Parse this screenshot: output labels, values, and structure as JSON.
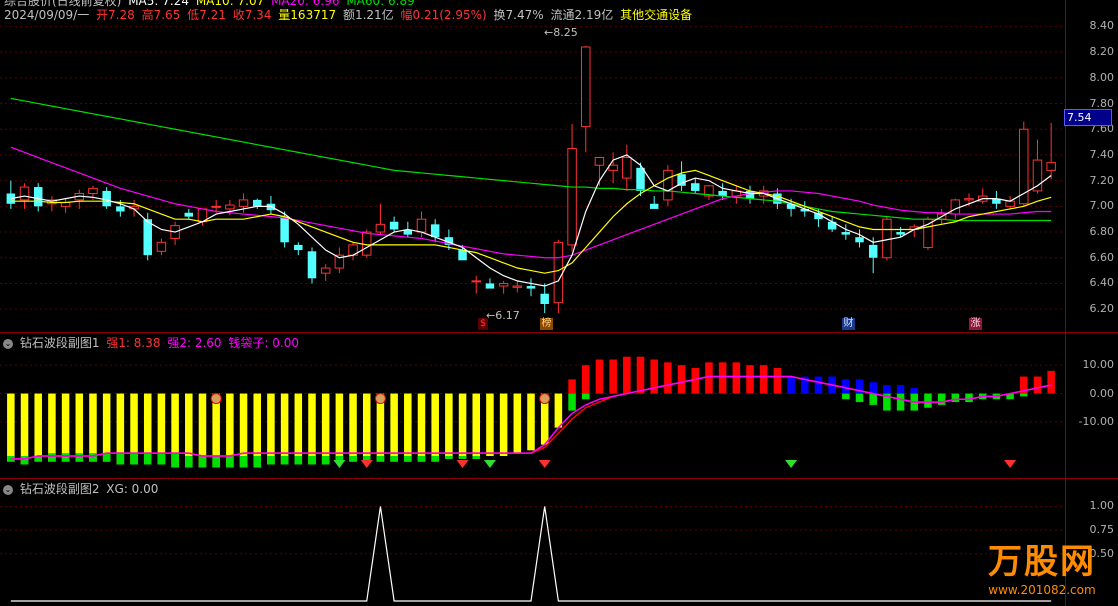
{
  "main": {
    "header": {
      "title": "综合股价(日线前复权)",
      "ma5": "MA5: 7.24",
      "ma10": "MA10: 7.07",
      "ma20": "MA20: 6.96",
      "ma60": "MA60: 6.89",
      "date": "2024/09/09/一",
      "open": "开7.28",
      "high": "高7.65",
      "low": "低7.21",
      "close": "收7.34",
      "volume": "量163717",
      "amount": "额1.21亿",
      "change": "幅0.21(2.95%)",
      "turnover": "换7.47%",
      "float": "流通2.19亿",
      "industry": "其他交通设备"
    },
    "price_marks": {
      "high_mark": "8.25",
      "low_mark": "6.17",
      "current_price": "7.54"
    },
    "event_tags": [
      "$",
      "榜",
      "财",
      "涨"
    ],
    "y_ticks": [
      "8.40",
      "8.20",
      "8.00",
      "7.80",
      "7.60",
      "7.40",
      "7.20",
      "7.00",
      "6.80",
      "6.60",
      "6.40",
      "6.20"
    ],
    "colors": {
      "up": "#ff3232",
      "down": "#54ffff",
      "ma5": "#ffffff",
      "ma10": "#ffff00",
      "ma20": "#ff00ff",
      "ma60": "#00e000"
    }
  },
  "sub1": {
    "title": "钻石波段副图1",
    "strong1": "强1: 8.38",
    "strong2": "强2: 2.60",
    "wallet": "钱袋子: 0.00",
    "y_ticks": [
      "10.00",
      "0.00",
      "-10.00"
    ],
    "colors": {
      "yellow": "#ffff00",
      "green": "#00e000",
      "red": "#ff0000",
      "blue": "#0000ff",
      "magenta": "#ff00ff"
    }
  },
  "sub2": {
    "title": "钻石波段副图2",
    "xg": "XG: 0.00",
    "y_ticks": [
      "1.00",
      "0.75",
      "0.50"
    ]
  },
  "watermark": {
    "brand": "万股网",
    "url": "www.201082.com"
  },
  "chart_data": [
    {
      "type": "candlestick",
      "title": "综合股价(日线前复权)",
      "ylim": [
        6.1,
        8.45
      ],
      "ohlc": [
        [
          7.1,
          7.2,
          6.98,
          7.02
        ],
        [
          7.05,
          7.18,
          6.98,
          7.15
        ],
        [
          7.15,
          7.18,
          6.96,
          7.0
        ],
        [
          7.02,
          7.08,
          6.96,
          7.05
        ],
        [
          7.0,
          7.06,
          6.95,
          7.03
        ],
        [
          7.05,
          7.13,
          6.98,
          7.1
        ],
        [
          7.1,
          7.16,
          7.05,
          7.14
        ],
        [
          7.12,
          7.15,
          6.98,
          7.0
        ],
        [
          7.0,
          7.05,
          6.92,
          6.96
        ],
        [
          6.98,
          7.05,
          6.92,
          7.0
        ],
        [
          6.9,
          6.95,
          6.58,
          6.62
        ],
        [
          6.65,
          6.75,
          6.62,
          6.72
        ],
        [
          6.75,
          6.88,
          6.7,
          6.85
        ],
        [
          6.95,
          6.98,
          6.9,
          6.92
        ],
        [
          6.88,
          6.98,
          6.85,
          6.98
        ],
        [
          7.0,
          7.05,
          6.95,
          7.0
        ],
        [
          6.98,
          7.05,
          6.93,
          7.01
        ],
        [
          7.0,
          7.1,
          6.95,
          7.05
        ],
        [
          7.05,
          7.06,
          6.98,
          7.0
        ],
        [
          7.02,
          7.08,
          6.94,
          6.97
        ],
        [
          6.92,
          6.96,
          6.68,
          6.72
        ],
        [
          6.7,
          6.72,
          6.62,
          6.66
        ],
        [
          6.65,
          6.68,
          6.4,
          6.44
        ],
        [
          6.48,
          6.55,
          6.42,
          6.52
        ],
        [
          6.52,
          6.68,
          6.48,
          6.62
        ],
        [
          6.62,
          6.72,
          6.58,
          6.7
        ],
        [
          6.62,
          6.82,
          6.6,
          6.8
        ],
        [
          6.8,
          7.02,
          6.78,
          6.86
        ],
        [
          6.88,
          6.92,
          6.8,
          6.82
        ],
        [
          6.82,
          6.88,
          6.76,
          6.78
        ],
        [
          6.8,
          6.96,
          6.76,
          6.9
        ],
        [
          6.86,
          6.9,
          6.72,
          6.76
        ],
        [
          6.76,
          6.82,
          6.66,
          6.7
        ],
        [
          6.66,
          6.7,
          6.6,
          6.58
        ],
        [
          6.42,
          6.46,
          6.32,
          6.42
        ],
        [
          6.4,
          6.44,
          6.38,
          6.36
        ],
        [
          6.38,
          6.42,
          6.32,
          6.4
        ],
        [
          6.37,
          6.42,
          6.33,
          6.38
        ],
        [
          6.38,
          6.44,
          6.3,
          6.36
        ],
        [
          6.32,
          6.4,
          6.17,
          6.24
        ],
        [
          6.25,
          6.74,
          6.17,
          6.72
        ],
        [
          6.7,
          7.64,
          6.65,
          7.45
        ],
        [
          7.62,
          8.25,
          7.42,
          8.24
        ],
        [
          7.32,
          7.36,
          7.16,
          7.38
        ],
        [
          7.28,
          7.42,
          7.18,
          7.32
        ],
        [
          7.22,
          7.48,
          7.12,
          7.38
        ],
        [
          7.3,
          7.34,
          7.08,
          7.12
        ],
        [
          7.02,
          7.08,
          6.98,
          6.98
        ],
        [
          7.05,
          7.32,
          7.0,
          7.28
        ],
        [
          7.25,
          7.35,
          7.12,
          7.16
        ],
        [
          7.18,
          7.22,
          7.1,
          7.12
        ],
        [
          7.08,
          7.16,
          7.05,
          7.16
        ],
        [
          7.12,
          7.18,
          7.05,
          7.08
        ],
        [
          7.08,
          7.16,
          7.02,
          7.12
        ],
        [
          7.12,
          7.16,
          7.02,
          7.06
        ],
        [
          7.08,
          7.16,
          7.02,
          7.12
        ],
        [
          7.1,
          7.14,
          6.98,
          7.02
        ],
        [
          7.02,
          7.06,
          6.92,
          6.98
        ],
        [
          6.98,
          7.04,
          6.92,
          6.96
        ],
        [
          6.95,
          6.98,
          6.84,
          6.9
        ],
        [
          6.88,
          6.92,
          6.8,
          6.82
        ],
        [
          6.8,
          6.86,
          6.74,
          6.78
        ],
        [
          6.76,
          6.82,
          6.68,
          6.72
        ],
        [
          6.7,
          6.76,
          6.48,
          6.6
        ],
        [
          6.6,
          6.92,
          6.58,
          6.9
        ],
        [
          6.8,
          6.84,
          6.76,
          6.78
        ],
        [
          6.82,
          6.86,
          6.76,
          6.84
        ],
        [
          6.68,
          6.92,
          6.66,
          6.9
        ],
        [
          6.9,
          6.98,
          6.86,
          6.94
        ],
        [
          6.94,
          7.06,
          6.9,
          7.05
        ],
        [
          7.05,
          7.1,
          7.0,
          7.06
        ],
        [
          7.04,
          7.14,
          7.02,
          7.08
        ],
        [
          7.06,
          7.12,
          6.98,
          7.02
        ],
        [
          7.0,
          7.08,
          6.98,
          7.04
        ],
        [
          7.02,
          7.66,
          7.0,
          7.6
        ],
        [
          7.12,
          7.52,
          7.1,
          7.36
        ],
        [
          7.28,
          7.65,
          7.21,
          7.34
        ]
      ],
      "ma5": [
        7.06,
        7.08,
        7.06,
        7.04,
        7.06,
        7.08,
        7.07,
        7.05,
        7.02,
        6.98,
        6.88,
        6.82,
        6.8,
        6.84,
        6.88,
        6.94,
        6.96,
        6.98,
        7.0,
        7.0,
        6.94,
        6.86,
        6.76,
        6.66,
        6.6,
        6.62,
        6.68,
        6.74,
        6.8,
        6.82,
        6.8,
        6.76,
        6.72,
        6.68,
        6.6,
        6.52,
        6.46,
        6.42,
        6.4,
        6.38,
        6.42,
        6.62,
        6.96,
        7.2,
        7.36,
        7.4,
        7.32,
        7.16,
        7.12,
        7.18,
        7.22,
        7.2,
        7.14,
        7.12,
        7.1,
        7.1,
        7.06,
        7.02,
        6.98,
        6.94,
        6.88,
        6.82,
        6.78,
        6.72,
        6.74,
        6.76,
        6.82,
        6.86,
        6.92,
        6.98,
        7.02,
        7.06,
        7.06,
        7.04,
        7.1,
        7.16,
        7.24
      ],
      "ma10": [
        7.04,
        7.04,
        7.04,
        7.03,
        7.03,
        7.04,
        7.04,
        7.04,
        7.03,
        7.02,
        6.98,
        6.94,
        6.9,
        6.9,
        6.88,
        6.9,
        6.9,
        6.9,
        6.92,
        6.94,
        6.92,
        6.88,
        6.84,
        6.8,
        6.76,
        6.72,
        6.7,
        6.7,
        6.7,
        6.7,
        6.7,
        6.7,
        6.68,
        6.66,
        6.64,
        6.6,
        6.56,
        6.52,
        6.5,
        6.48,
        6.5,
        6.56,
        6.68,
        6.8,
        6.92,
        7.02,
        7.1,
        7.16,
        7.22,
        7.26,
        7.28,
        7.24,
        7.2,
        7.16,
        7.12,
        7.1,
        7.08,
        7.04,
        7.0,
        6.96,
        6.92,
        6.88,
        6.84,
        6.82,
        6.82,
        6.82,
        6.82,
        6.84,
        6.86,
        6.88,
        6.92,
        6.94,
        6.96,
        6.98,
        7.0,
        7.04,
        7.07
      ],
      "ma20": [
        7.46,
        7.42,
        7.38,
        7.34,
        7.3,
        7.26,
        7.22,
        7.18,
        7.14,
        7.11,
        7.08,
        7.05,
        7.02,
        7.0,
        6.98,
        6.96,
        6.95,
        6.94,
        6.93,
        6.92,
        6.91,
        6.89,
        6.87,
        6.85,
        6.83,
        6.81,
        6.79,
        6.78,
        6.77,
        6.76,
        6.75,
        6.73,
        6.71,
        6.69,
        6.67,
        6.65,
        6.63,
        6.62,
        6.61,
        6.6,
        6.6,
        6.62,
        6.66,
        6.7,
        6.74,
        6.78,
        6.82,
        6.86,
        6.9,
        6.94,
        6.98,
        7.02,
        7.06,
        7.08,
        7.1,
        7.11,
        7.12,
        7.12,
        7.11,
        7.1,
        7.08,
        7.06,
        7.04,
        7.01,
        6.99,
        6.97,
        6.96,
        6.95,
        6.95,
        6.94,
        6.94,
        6.94,
        6.94,
        6.94,
        6.95,
        6.96,
        6.96
      ],
      "ma60": [
        7.84,
        7.82,
        7.8,
        7.78,
        7.76,
        7.74,
        7.72,
        7.7,
        7.68,
        7.66,
        7.64,
        7.62,
        7.6,
        7.58,
        7.56,
        7.54,
        7.52,
        7.5,
        7.48,
        7.46,
        7.44,
        7.42,
        7.4,
        7.38,
        7.36,
        7.34,
        7.32,
        7.3,
        7.28,
        7.27,
        7.26,
        7.25,
        7.24,
        7.23,
        7.22,
        7.21,
        7.2,
        7.19,
        7.18,
        7.17,
        7.16,
        7.15,
        7.15,
        7.14,
        7.14,
        7.13,
        7.13,
        7.12,
        7.12,
        7.11,
        7.1,
        7.09,
        7.08,
        7.07,
        7.06,
        7.05,
        7.04,
        7.02,
        7.0,
        6.98,
        6.96,
        6.95,
        6.94,
        6.93,
        6.92,
        6.91,
        6.9,
        6.9,
        6.9,
        6.89,
        6.89,
        6.89,
        6.89,
        6.89,
        6.89,
        6.89,
        6.89
      ]
    },
    {
      "type": "bar",
      "title": "钻石波段副图1",
      "ylim": [
        -28,
        15
      ],
      "bars": [
        -24,
        -25,
        -24,
        -24,
        -24,
        -24,
        -24,
        -24,
        -25,
        -25,
        -25,
        -25,
        -26,
        -26,
        -26,
        -26,
        -26,
        -26,
        -26,
        -25,
        -25,
        -25,
        -25,
        -25,
        -24,
        -24,
        -24,
        -24,
        -24,
        -24,
        -24,
        -24,
        -23,
        -23,
        -23,
        -22,
        -22,
        -21,
        -20,
        -18,
        -12,
        -6,
        -2,
        0,
        0,
        0,
        0,
        0,
        0,
        0,
        0,
        0,
        0,
        0,
        0,
        0,
        0,
        0,
        0,
        0,
        0,
        -2,
        -3,
        -4,
        -6,
        -6,
        -6,
        -5,
        -4,
        -3,
        -3,
        -2,
        -2,
        -2,
        -1,
        0,
        0
      ],
      "overlay": [
        -22,
        -22,
        -22,
        -21,
        -21,
        -21,
        -21,
        -21,
        -21,
        -21,
        -21,
        -21,
        -21,
        -22,
        -22,
        -22,
        -22,
        -22,
        -22,
        -22,
        -22,
        -22,
        -22,
        -22,
        -22,
        -22,
        -22,
        -22,
        -22,
        -22,
        -22,
        -22,
        -22,
        -22,
        -22,
        -22,
        -22,
        -22,
        -22,
        -20,
        -13,
        -5,
        -1,
        0,
        0,
        0,
        0,
        0,
        0,
        0,
        0,
        0,
        0,
        0,
        0,
        0,
        0,
        0,
        0,
        0,
        0,
        0,
        0,
        0,
        0,
        0,
        0,
        0,
        0,
        0,
        0,
        0,
        0,
        0,
        0,
        0,
        0
      ],
      "top_red": [
        0,
        0,
        0,
        0,
        0,
        0,
        0,
        0,
        0,
        0,
        0,
        0,
        0,
        0,
        0,
        0,
        0,
        0,
        0,
        0,
        0,
        0,
        0,
        0,
        0,
        0,
        0,
        0,
        0,
        0,
        0,
        0,
        0,
        0,
        0,
        0,
        0,
        0,
        0,
        0,
        0,
        5,
        10,
        12,
        12,
        13,
        13,
        12,
        11,
        10,
        9,
        11,
        11,
        11,
        10,
        10,
        9,
        0,
        0,
        0,
        0,
        0,
        0,
        0,
        0,
        0,
        0,
        0,
        0,
        0,
        0,
        0,
        0,
        0,
        6,
        6,
        8
      ],
      "top_blue": [
        0,
        0,
        0,
        0,
        0,
        0,
        0,
        0,
        0,
        0,
        0,
        0,
        0,
        0,
        0,
        0,
        0,
        0,
        0,
        0,
        0,
        0,
        0,
        0,
        0,
        0,
        0,
        0,
        0,
        0,
        0,
        0,
        0,
        0,
        0,
        0,
        0,
        0,
        0,
        0,
        0,
        0,
        0,
        0,
        0,
        0,
        0,
        0,
        0,
        0,
        0,
        0,
        0,
        0,
        0,
        0,
        0,
        6,
        6,
        6,
        6,
        5,
        5,
        4,
        3,
        3,
        2,
        0,
        0,
        0,
        0,
        0,
        0,
        0,
        0,
        0,
        0,
        0
      ],
      "line1": [
        -23,
        -23,
        -22,
        -22,
        -22,
        -22,
        -22,
        -21,
        -21,
        -21,
        -21,
        -21,
        -21,
        -21,
        -22,
        -22,
        -22,
        -21,
        -21,
        -21,
        -21,
        -21,
        -21,
        -21,
        -21,
        -21,
        -21,
        -21,
        -21,
        -21,
        -21,
        -21,
        -21,
        -21,
        -21,
        -21,
        -21,
        -21,
        -21,
        -18,
        -12,
        -7,
        -4,
        -2,
        -1,
        0,
        1,
        2,
        3,
        4,
        5,
        6,
        6,
        6,
        6,
        6,
        6,
        6,
        5,
        4,
        3,
        2,
        1,
        0,
        -1,
        -2,
        -3,
        -3,
        -3,
        -2,
        -2,
        -1,
        -1,
        0,
        1,
        2,
        3
      ],
      "line2": [
        -23,
        -23,
        -22,
        -22,
        -22,
        -22,
        -22,
        -21,
        -21,
        -21,
        -21,
        -21,
        -21,
        -21,
        -22,
        -22,
        -22,
        -21,
        -21,
        -21,
        -21,
        -21,
        -21,
        -21,
        -21,
        -21,
        -21,
        -21,
        -21,
        -21,
        -21,
        -21,
        -21,
        -21,
        -21,
        -21,
        -21,
        -21,
        -21,
        -19,
        -14,
        -9,
        -5,
        -3,
        -1,
        0,
        1,
        2,
        3,
        4,
        5,
        6,
        6,
        6,
        6,
        6,
        6,
        6,
        5,
        4,
        3,
        2,
        1,
        0,
        -1,
        -2,
        -3,
        -3,
        -3,
        -2,
        -2,
        -1,
        -1,
        0,
        1,
        2,
        3
      ],
      "diamonds_green": [
        24,
        35,
        57
      ],
      "diamonds_red": [
        26,
        33,
        39,
        73
      ],
      "money_bags": [
        15,
        27,
        39
      ]
    },
    {
      "type": "line",
      "title": "钻石波段副图2",
      "ylim": [
        0,
        1.1
      ],
      "spikes": [
        27,
        39
      ]
    }
  ]
}
